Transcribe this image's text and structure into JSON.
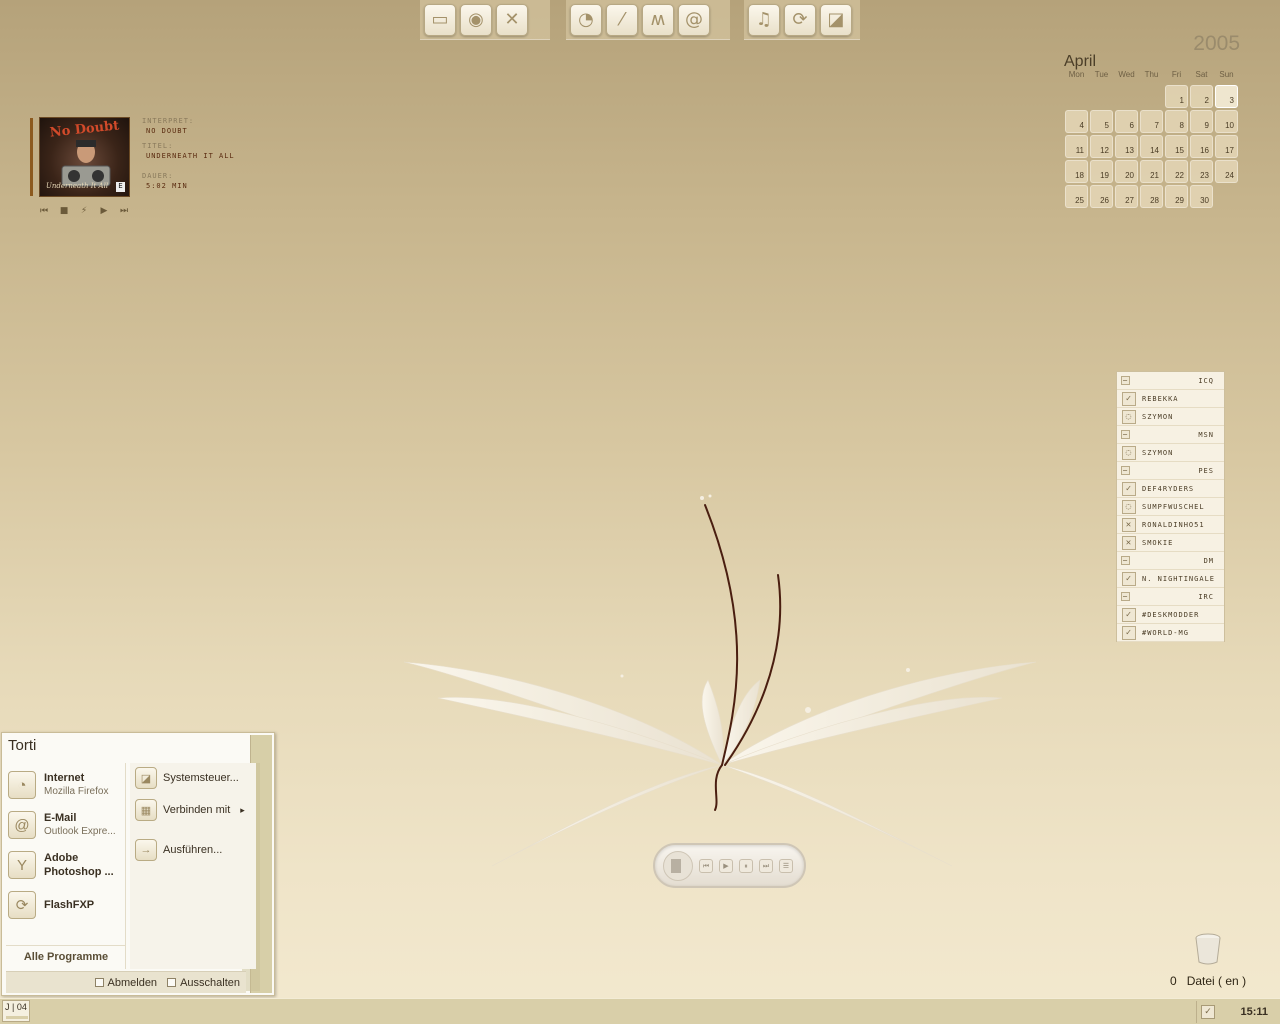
{
  "dock": {
    "group1": [
      {
        "name": "my-computer-icon",
        "glyph": "▭"
      },
      {
        "name": "disc-icon",
        "glyph": "◉"
      },
      {
        "name": "tools-icon",
        "glyph": "✕"
      }
    ],
    "group2": [
      {
        "name": "browser-icon",
        "glyph": "◔"
      },
      {
        "name": "feather-icon",
        "glyph": "⁄"
      },
      {
        "name": "messenger-icon",
        "glyph": "ʍ"
      },
      {
        "name": "email-icon",
        "glyph": "@"
      }
    ],
    "group3": [
      {
        "name": "music-icon",
        "glyph": "♫"
      },
      {
        "name": "sync-icon",
        "glyph": "⟳"
      },
      {
        "name": "control-panel-icon",
        "glyph": "◪"
      }
    ]
  },
  "calendar": {
    "year": "2005",
    "month": "April",
    "weekdays": [
      "Mon",
      "Tue",
      "Wed",
      "Thu",
      "Fri",
      "Sat",
      "Sun"
    ],
    "days": [
      "",
      "",
      "",
      "",
      "1",
      "2",
      "3",
      "4",
      "5",
      "6",
      "7",
      "8",
      "9",
      "10",
      "11",
      "12",
      "13",
      "14",
      "15",
      "16",
      "17",
      "18",
      "19",
      "20",
      "21",
      "22",
      "23",
      "24",
      "25",
      "26",
      "27",
      "28",
      "29",
      "30"
    ],
    "today": "3"
  },
  "music": {
    "cover_title": "No Doubt",
    "cover_subtitle": "Underneath It All",
    "cover_mark": "E",
    "interpret_label": "Interpret:",
    "interpret": "No Doubt",
    "titel_label": "Titel:",
    "titel": "Underneath It All",
    "dauer_label": "Dauer:",
    "dauer": "5:02 min",
    "controls": [
      "⏮",
      "■",
      "⚡",
      "▶",
      "⏭"
    ]
  },
  "contacts": [
    {
      "type": "group",
      "label": "ICQ"
    },
    {
      "type": "contact",
      "label": "Rebekka",
      "status": "check"
    },
    {
      "type": "contact",
      "label": "Szymon",
      "status": "away"
    },
    {
      "type": "group",
      "label": "MSN"
    },
    {
      "type": "contact",
      "label": "Szymon",
      "status": "away"
    },
    {
      "type": "group",
      "label": "PES"
    },
    {
      "type": "contact",
      "label": "Def4ryders",
      "status": "check"
    },
    {
      "type": "contact",
      "label": "Sumpfwuschel",
      "status": "away"
    },
    {
      "type": "contact",
      "label": "Ronaldinho51",
      "status": "offline"
    },
    {
      "type": "contact",
      "label": "Smokie",
      "status": "offline"
    },
    {
      "type": "group",
      "label": "DM"
    },
    {
      "type": "contact",
      "label": "N. Nightingale",
      "status": "check"
    },
    {
      "type": "group",
      "label": "IRC"
    },
    {
      "type": "contact",
      "label": "#deskmodder",
      "status": "check"
    },
    {
      "type": "contact",
      "label": "#world-mg",
      "status": "check"
    }
  ],
  "trash": {
    "count": "0",
    "label": "Datei ( en )"
  },
  "start_menu": {
    "user": "Torti",
    "pinned": [
      {
        "title": "Internet",
        "subtitle": "Mozilla Firefox",
        "icon": "◔"
      },
      {
        "title": "E-Mail",
        "subtitle": "Outlook Expre...",
        "icon": "@"
      },
      {
        "title": "Adobe",
        "subtitle": "Photoshop ...",
        "icon": "Y"
      },
      {
        "title": "FlashFXP",
        "subtitle": "",
        "icon": "⟳"
      }
    ],
    "all_programs": "Alle Programme",
    "right": [
      {
        "label": "Systemsteuer...",
        "icon": "◪"
      },
      {
        "label": "Verbinden mit",
        "icon": "▦",
        "arrow": "▸"
      },
      {
        "label": "Ausführen...",
        "icon": "→"
      }
    ],
    "logoff": "Abmelden",
    "shutdown": "Ausschalten"
  },
  "taskbar": {
    "start_label": "J | 04",
    "clock": "15:11"
  },
  "player": {
    "buttons": [
      "⏮",
      "▶",
      "⏸",
      "⏭",
      "☰"
    ]
  }
}
